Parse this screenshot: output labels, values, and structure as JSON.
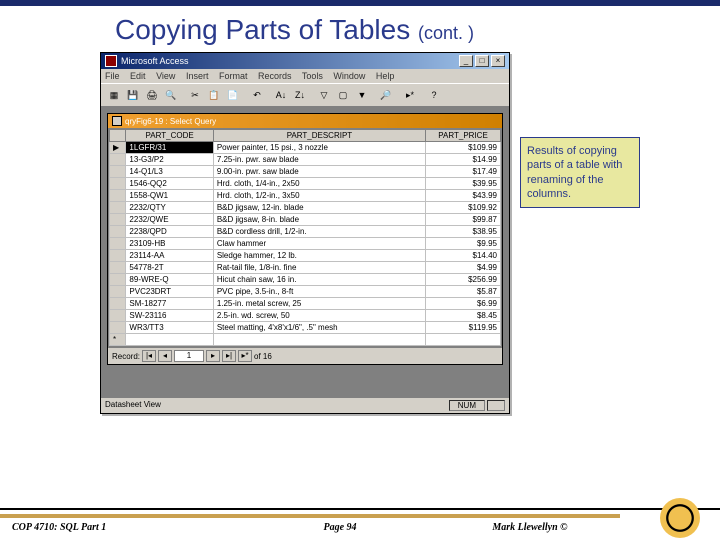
{
  "slide": {
    "title_main": "Copying Parts of Tables",
    "title_cont": "(cont. )"
  },
  "access": {
    "app_title": "Microsoft Access",
    "menus": [
      "File",
      "Edit",
      "View",
      "Insert",
      "Format",
      "Records",
      "Tools",
      "Window",
      "Help"
    ],
    "query_title": "qryFig6-19 : Select Query",
    "status_left": "Datasheet View",
    "status_num": "NUM",
    "columns": [
      "",
      "PART_CODE",
      "PART_DESCRIPT",
      "PART_PRICE"
    ],
    "records_label": "Record:",
    "records_current": "1",
    "records_total": "of 16",
    "rows": [
      [
        "▶",
        "1LGFR/31",
        "Power painter, 15 psi., 3 nozzle",
        "$109.99"
      ],
      [
        "",
        "13-G3/P2",
        "7.25-in. pwr. saw blade",
        "$14.99"
      ],
      [
        "",
        "14-Q1/L3",
        "9.00-in. pwr. saw blade",
        "$17.49"
      ],
      [
        "",
        "1546-QQ2",
        "Hrd. cloth, 1/4-in., 2x50",
        "$39.95"
      ],
      [
        "",
        "1558-QW1",
        "Hrd. cloth, 1/2-in., 3x50",
        "$43.99"
      ],
      [
        "",
        "2232/QTY",
        "B&D jigsaw, 12-in. blade",
        "$109.92"
      ],
      [
        "",
        "2232/QWE",
        "B&D jigsaw, 8-in. blade",
        "$99.87"
      ],
      [
        "",
        "2238/QPD",
        "B&D cordless drill, 1/2-in.",
        "$38.95"
      ],
      [
        "",
        "23109-HB",
        "Claw hammer",
        "$9.95"
      ],
      [
        "",
        "23114-AA",
        "Sledge hammer, 12 lb.",
        "$14.40"
      ],
      [
        "",
        "54778-2T",
        "Rat-tail file, 1/8-in. fine",
        "$4.99"
      ],
      [
        "",
        "89-WRE-Q",
        "Hicut chain saw, 16 in.",
        "$256.99"
      ],
      [
        "",
        "PVC23DRT",
        "PVC pipe, 3.5-in., 8-ft",
        "$5.87"
      ],
      [
        "",
        "SM-18277",
        "1.25-in. metal screw, 25",
        "$6.99"
      ],
      [
        "",
        "SW-23116",
        "2.5-in. wd. screw, 50",
        "$8.45"
      ],
      [
        "",
        "WR3/TT3",
        "Steel matting, 4'x8'x1/6\", .5\" mesh",
        "$119.95"
      ],
      [
        "*",
        "",
        "",
        ""
      ]
    ]
  },
  "callout": {
    "text": "Results of copying parts of a table with renaming of the columns."
  },
  "footer": {
    "course": "COP 4710: SQL Part 1",
    "page": "Page 94",
    "author": "Mark Llewellyn ©"
  }
}
